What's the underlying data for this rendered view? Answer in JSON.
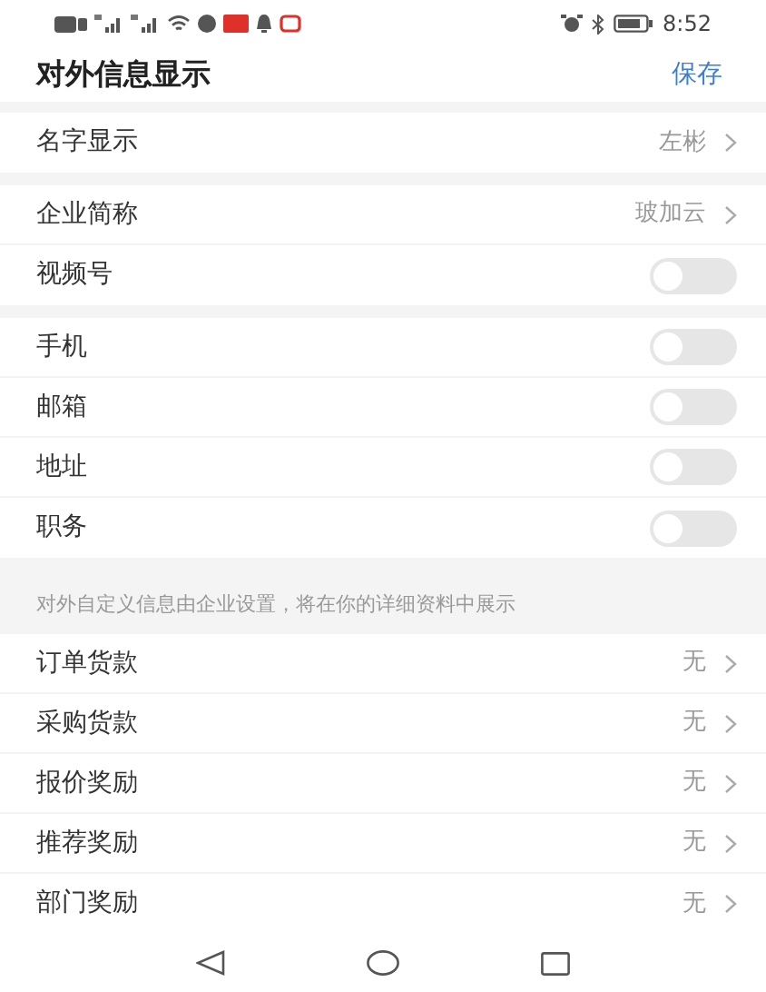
{
  "status_bar": {
    "time": "8:52"
  },
  "header": {
    "title": "对外信息显示",
    "action": "保存"
  },
  "sections": [
    {
      "rows": [
        {
          "kind": "value",
          "label": "名字显示",
          "value": "左彬"
        }
      ]
    },
    {
      "rows": [
        {
          "kind": "value",
          "label": "企业简称",
          "value": "玻加云"
        },
        {
          "kind": "toggle",
          "label": "视频号",
          "on": false
        }
      ]
    },
    {
      "rows": [
        {
          "kind": "toggle",
          "label": "手机",
          "on": false
        },
        {
          "kind": "toggle",
          "label": "邮箱",
          "on": false
        },
        {
          "kind": "toggle",
          "label": "地址",
          "on": false
        },
        {
          "kind": "toggle",
          "label": "职务",
          "on": false
        }
      ]
    },
    {
      "note": "对外自定义信息由企业设置，将在你的详细资料中展示",
      "rows": [
        {
          "kind": "value",
          "label": "订单货款",
          "value": "无"
        },
        {
          "kind": "value",
          "label": "采购货款",
          "value": "无"
        },
        {
          "kind": "value",
          "label": "报价奖励",
          "value": "无"
        },
        {
          "kind": "value",
          "label": "推荐奖励",
          "value": "无"
        },
        {
          "kind": "value",
          "label": "部门奖励",
          "value": "无"
        }
      ]
    }
  ]
}
